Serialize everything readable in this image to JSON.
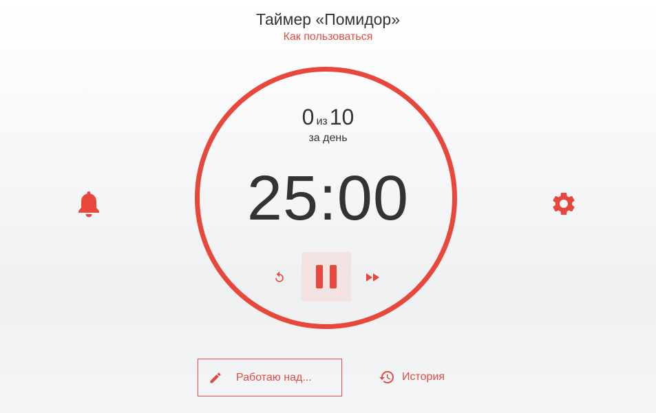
{
  "header": {
    "title": "Таймер «Помидор»",
    "howto_link": "Как пользоваться"
  },
  "counter": {
    "done": "0",
    "of": "из",
    "goal": "10",
    "period": "за день"
  },
  "timer": {
    "display": "25:00"
  },
  "controls": {
    "reset_icon": "restart-icon",
    "pause_icon": "pause-icon",
    "skip_icon": "fast-forward-icon"
  },
  "side": {
    "left_icon": "bell-icon",
    "right_icon": "gear-icon"
  },
  "footer": {
    "task_label": "Работаю над...",
    "history_label": "История"
  },
  "colors": {
    "accent": "#e8473b",
    "text": "#333333",
    "pause_bg": "#f3e3e2"
  }
}
